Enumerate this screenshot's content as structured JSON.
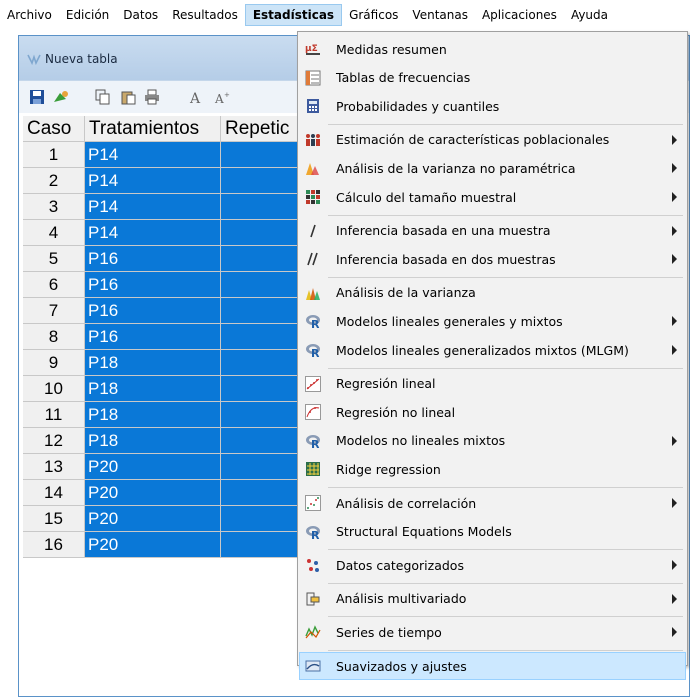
{
  "menubar": [
    {
      "label": "Archivo",
      "active": false
    },
    {
      "label": "Edición",
      "active": false
    },
    {
      "label": "Datos",
      "active": false
    },
    {
      "label": "Resultados",
      "active": false
    },
    {
      "label": "Estadísticas",
      "active": true
    },
    {
      "label": "Gráficos",
      "active": false
    },
    {
      "label": "Ventanas",
      "active": false
    },
    {
      "label": "Aplicaciones",
      "active": false
    },
    {
      "label": "Ayuda",
      "active": false
    }
  ],
  "window": {
    "title": "Nueva tabla",
    "toolbar_icons": [
      "save-icon",
      "open-icon",
      "copy-icon",
      "paste-icon",
      "print-icon",
      "font-icon",
      "font-size-icon"
    ]
  },
  "table": {
    "columns": [
      "Caso",
      "Tratamientos",
      "Repetic"
    ],
    "rows": [
      {
        "caso": "1",
        "trat": "P14"
      },
      {
        "caso": "2",
        "trat": "P14"
      },
      {
        "caso": "3",
        "trat": "P14"
      },
      {
        "caso": "4",
        "trat": "P14"
      },
      {
        "caso": "5",
        "trat": "P16"
      },
      {
        "caso": "6",
        "trat": "P16"
      },
      {
        "caso": "7",
        "trat": "P16"
      },
      {
        "caso": "8",
        "trat": "P16"
      },
      {
        "caso": "9",
        "trat": "P18"
      },
      {
        "caso": "10",
        "trat": "P18"
      },
      {
        "caso": "11",
        "trat": "P18"
      },
      {
        "caso": "12",
        "trat": "P18"
      },
      {
        "caso": "13",
        "trat": "P20"
      },
      {
        "caso": "14",
        "trat": "P20"
      },
      {
        "caso": "15",
        "trat": "P20"
      },
      {
        "caso": "16",
        "trat": "P20"
      }
    ]
  },
  "menu": {
    "groups": [
      [
        {
          "label": "Medidas resumen",
          "icon": "summary-icon",
          "submenu": false
        },
        {
          "label": "Tablas de frecuencias",
          "icon": "frequency-table-icon",
          "submenu": false
        },
        {
          "label": "Probabilidades y cuantiles",
          "icon": "calculator-icon",
          "submenu": false
        }
      ],
      [
        {
          "label": "Estimación de características poblacionales",
          "icon": "population-icon",
          "submenu": true
        },
        {
          "label": "Análisis de la varianza no paramétrica",
          "icon": "nonparametric-icon",
          "submenu": true
        },
        {
          "label": "Cálculo del tamaño muestral",
          "icon": "sample-size-icon",
          "submenu": true
        }
      ],
      [
        {
          "label": "Inferencia basada en una muestra",
          "icon": "one-sample-icon",
          "submenu": true
        },
        {
          "label": "Inferencia basada en dos muestras",
          "icon": "two-sample-icon",
          "submenu": true
        }
      ],
      [
        {
          "label": "Análisis de la varianza",
          "icon": "anova-icon",
          "submenu": false
        },
        {
          "label": "Modelos lineales generales y mixtos",
          "icon": "r-icon",
          "submenu": true
        },
        {
          "label": "Modelos lineales generalizados mixtos (MLGM)",
          "icon": "r-icon",
          "submenu": true
        }
      ],
      [
        {
          "label": "Regresión lineal",
          "icon": "linear-regression-icon",
          "submenu": false
        },
        {
          "label": "Regresión no lineal",
          "icon": "nonlinear-regression-icon",
          "submenu": false
        },
        {
          "label": "Modelos no lineales mixtos",
          "icon": "r-icon",
          "submenu": true
        },
        {
          "label": "Ridge regression",
          "icon": "ridge-icon",
          "submenu": false
        }
      ],
      [
        {
          "label": "Análisis de correlación",
          "icon": "correlation-icon",
          "submenu": true
        },
        {
          "label": "Structural Equations Models",
          "icon": "r-icon",
          "submenu": false
        }
      ],
      [
        {
          "label": "Datos categorizados",
          "icon": "categorical-icon",
          "submenu": true
        }
      ],
      [
        {
          "label": "Análisis multivariado",
          "icon": "multivariate-icon",
          "submenu": true
        }
      ],
      [
        {
          "label": "Series de tiempo",
          "icon": "time-series-icon",
          "submenu": true
        }
      ],
      [
        {
          "label": "Suavizados y ajustes",
          "icon": "smoothing-icon",
          "submenu": false,
          "highlighted": true
        }
      ]
    ]
  },
  "colors": {
    "selection": "#0a78d7",
    "menu_highlight": "#cce8ff",
    "menubar_active": "#cce4f7"
  }
}
